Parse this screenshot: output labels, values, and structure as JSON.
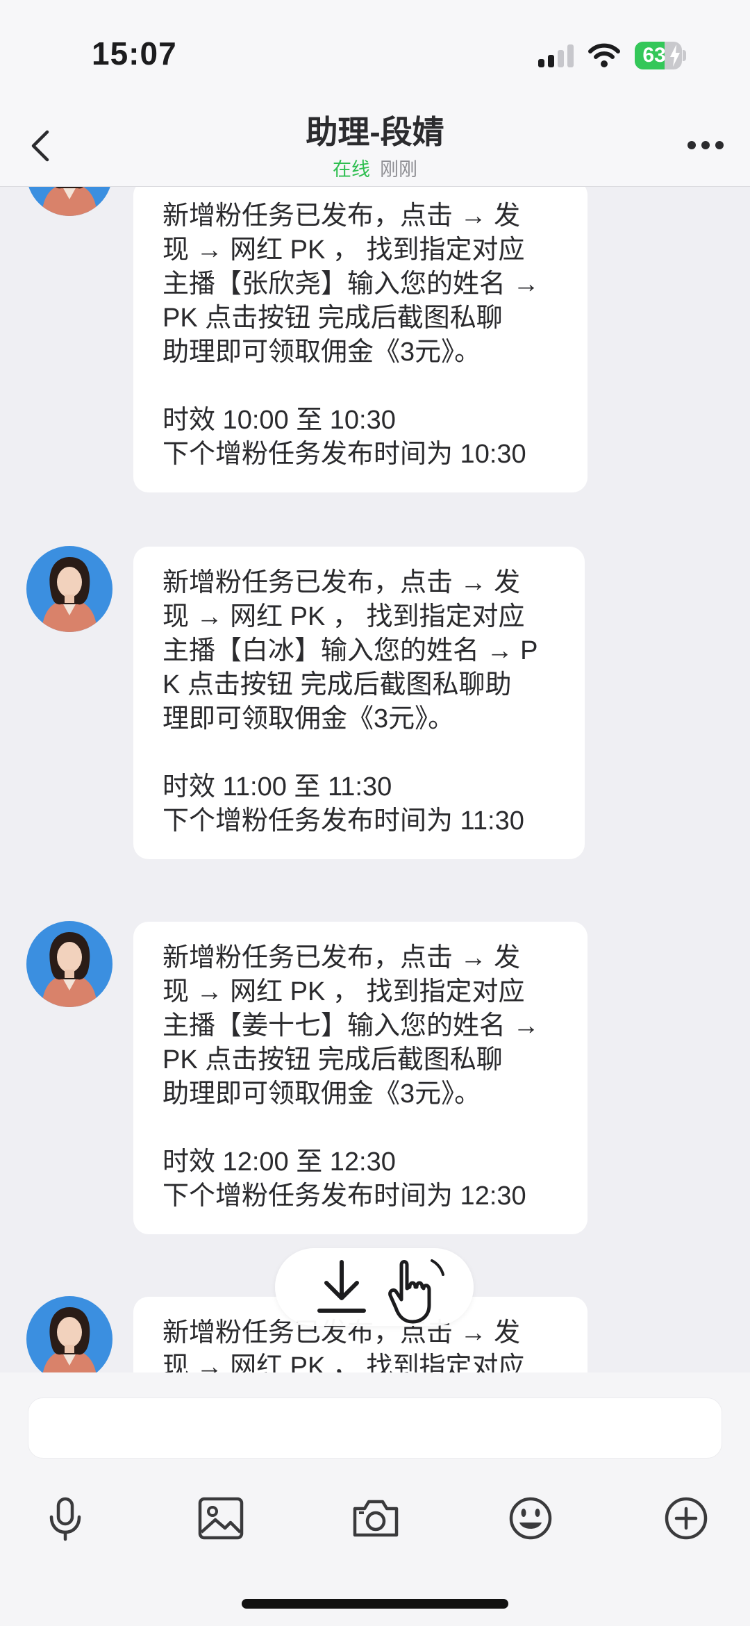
{
  "status_bar": {
    "time": "15:07",
    "battery": "63",
    "battery_level": 0.63
  },
  "header": {
    "title": "助理-段婧",
    "status": "在线",
    "last_seen": "刚刚"
  },
  "messages": [
    {
      "lines": [
        "新增粉任务已发布，点击 → 发",
        "现 → 网红 PK ， 找到指定对应",
        "主播【张欣尧】输入您的姓名 →",
        "PK  点击按钮 完成后截图私聊",
        "助理即可领取佣金《3元》。"
      ],
      "time_line": "时效 10:00 至 10:30",
      "next_line": "下个增粉任务发布时间为 10:30"
    },
    {
      "lines": [
        "新增粉任务已发布，点击 → 发",
        "现 → 网红 PK ， 找到指定对应",
        "主播【白冰】输入您的姓名 →  P",
        "K  点击按钮 完成后截图私聊助",
        "理即可领取佣金《3元》。"
      ],
      "time_line": "时效 11:00 至 11:30",
      "next_line": "下个增粉任务发布时间为 11:30"
    },
    {
      "lines": [
        "新增粉任务已发布，点击 → 发",
        "现 → 网红 PK ， 找到指定对应",
        "主播【姜十七】输入您的姓名 →",
        "PK  点击按钮 完成后截图私聊",
        "助理即可领取佣金《3元》。"
      ],
      "time_line": "时效 12:00 至 12:30",
      "next_line": "下个增粉任务发布时间为 12:30"
    },
    {
      "lines": [
        "新增粉任务已发布，点击 → 发",
        "现 → 网红 PK ， 找到指定对应"
      ]
    }
  ],
  "input": {
    "value": "",
    "placeholder": ""
  },
  "toolbar": {
    "icons": [
      "microphone-icon",
      "image-icon",
      "camera-icon",
      "emoji-icon",
      "plus-circle-icon"
    ]
  },
  "colors": {
    "online": "#2dbe4f",
    "battery": "#34c759",
    "background": "#efeff3",
    "bubble": "#ffffff"
  }
}
